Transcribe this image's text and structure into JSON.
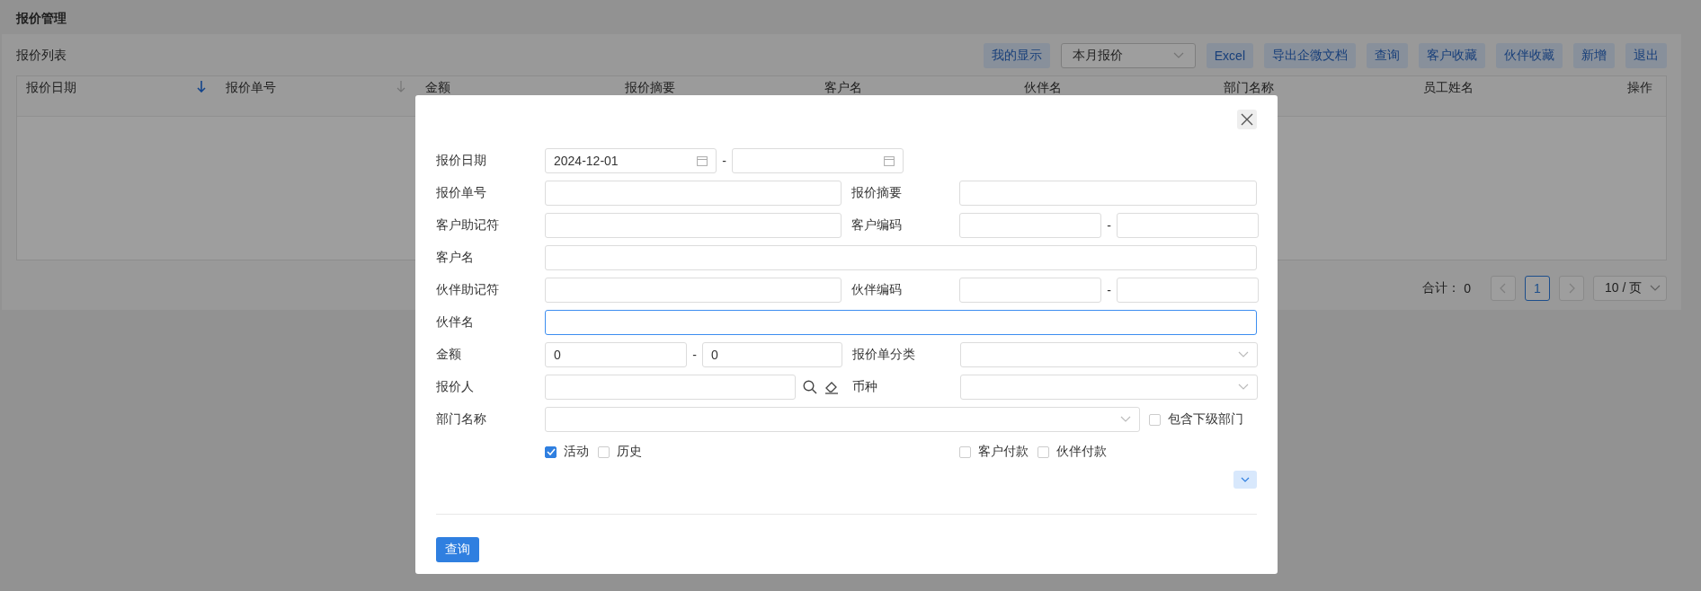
{
  "page_title": "报价管理",
  "panel_title": "报价列表",
  "toolbar": [
    {
      "kind": "button",
      "label": "我的显示"
    },
    {
      "kind": "select",
      "label": "本月报价"
    },
    {
      "kind": "button",
      "label": "Excel"
    },
    {
      "kind": "button",
      "label": "导出企微文档"
    },
    {
      "kind": "button",
      "label": "查询"
    },
    {
      "kind": "button",
      "label": "客户收藏"
    },
    {
      "kind": "button",
      "label": "伙伴收藏"
    },
    {
      "kind": "button",
      "label": "新增"
    },
    {
      "kind": "button",
      "label": "退出"
    }
  ],
  "table": {
    "columns": [
      {
        "kind": "sortable",
        "label": "报价日期",
        "sorted": true
      },
      {
        "kind": "sortable",
        "label": "报价单号",
        "sorted": false
      },
      {
        "kind": "plain",
        "label": "金额"
      },
      {
        "kind": "plain",
        "label": "报价摘要"
      },
      {
        "kind": "plain",
        "label": "客户名"
      },
      {
        "kind": "plain",
        "label": "伙伴名"
      },
      {
        "kind": "plain",
        "label": "部门名称"
      },
      {
        "kind": "plain",
        "label": "员工姓名"
      },
      {
        "kind": "plain",
        "label": "操作"
      }
    ]
  },
  "pagination": {
    "total_label": "合计：",
    "total": "0",
    "pages": [
      {
        "label": "1",
        "selected": true
      }
    ],
    "page_size": "10 / 页"
  },
  "dialog": {
    "rows": [
      {
        "kind": "date_range",
        "label": "报价日期",
        "from": "2024-12-01",
        "separator": "-"
      },
      {
        "kind": "pair",
        "label": "报价单号",
        "label2": "报价摘要"
      },
      {
        "kind": "pair_range",
        "label": "客户助记符",
        "label2": "客户编码",
        "separator": "-"
      },
      {
        "kind": "full",
        "label": "客户名",
        "focused": false
      },
      {
        "kind": "pair_range",
        "label": "伙伴助记符",
        "label2": "伙伴编码",
        "separator": "-"
      },
      {
        "kind": "full",
        "label": "伙伴名",
        "focused": true
      },
      {
        "kind": "range_select",
        "label": "金额",
        "from": "0",
        "to": "0",
        "separator": "-",
        "label2": "报价单分类"
      },
      {
        "kind": "lookup_select",
        "label": "报价人",
        "label2": "币种"
      },
      {
        "kind": "select_check",
        "label": "部门名称",
        "check_label": "包含下级部门",
        "checked": false
      }
    ],
    "checks_left": [
      {
        "label": "活动",
        "checked": true
      },
      {
        "label": "历史",
        "checked": false
      }
    ],
    "checks_right": [
      {
        "label": "客户付款",
        "checked": false
      },
      {
        "label": "伙伴付款",
        "checked": false
      }
    ],
    "submit": "查询"
  }
}
